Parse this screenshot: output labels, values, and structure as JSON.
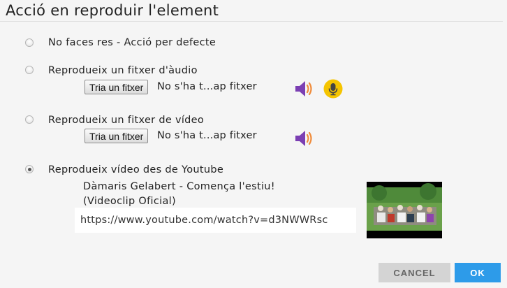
{
  "dialog": {
    "title": "Acció en reproduir l'element"
  },
  "options": {
    "none": {
      "label": "No faces res - Acció per defecte",
      "selected": false
    },
    "audio": {
      "label": "Reprodueix un fitxer d'àudio",
      "selected": false,
      "button": "Tria un fitxer",
      "file_status": "No s'ha t...ap fitxer",
      "icons": [
        "speaker-icon",
        "microphone-icon"
      ]
    },
    "video": {
      "label": "Reprodueix un fitxer de vídeo",
      "selected": false,
      "button": "Tria un fitxer",
      "file_status": "No s'ha t...ap fitxer",
      "icons": [
        "speaker-icon"
      ]
    },
    "youtube": {
      "label": "Reprodueix vídeo des de Youtube",
      "selected": true,
      "video_title": "Dàmaris Gelabert - Comença l'estiu! (Videoclip Oficial)",
      "url": "https://www.youtube.com/watch?v=d3NWWRsc"
    }
  },
  "buttons": {
    "cancel": "CANCEL",
    "ok": "OK"
  },
  "colors": {
    "accent": "#2d9be9",
    "speaker": "#7b3fb3",
    "microphone_bg": "#f5c400"
  }
}
